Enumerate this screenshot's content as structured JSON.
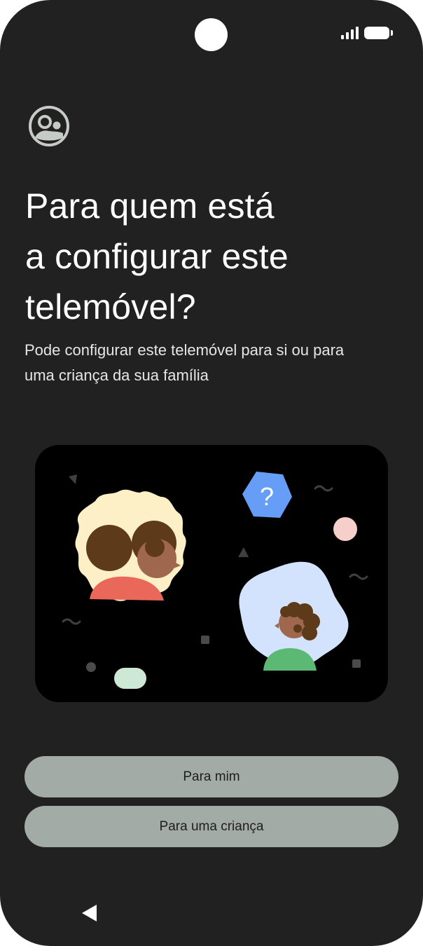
{
  "status_bar": {
    "signal_icon": "signal-icon",
    "battery_icon": "battery-icon"
  },
  "header": {
    "icon": "family-users-icon",
    "title_lines": [
      "Para quem está",
      "a configurar este",
      "telemóvel?"
    ],
    "subtitle_lines": [
      "Pode configurar este telemóvel para si ou para",
      "uma criança da sua família"
    ]
  },
  "illustration": {
    "badge_text": "?",
    "colors": {
      "background": "#000000",
      "adult_frame": "#fdefc6",
      "adult_shirt": "#ea6859",
      "child_frame": "#d4e3fd",
      "child_shirt": "#5bb974",
      "question_badge": "#669df6",
      "hair": "#5d3a1a",
      "skin": "#a0674f"
    }
  },
  "buttons": {
    "for_me": "Para mim",
    "for_child": "Para uma criança"
  },
  "navigation": {
    "back_icon": "back-triangle-icon"
  },
  "colors": {
    "screen_background": "#212121",
    "button_background": "#a3aba6",
    "text_primary": "#ffffff"
  }
}
